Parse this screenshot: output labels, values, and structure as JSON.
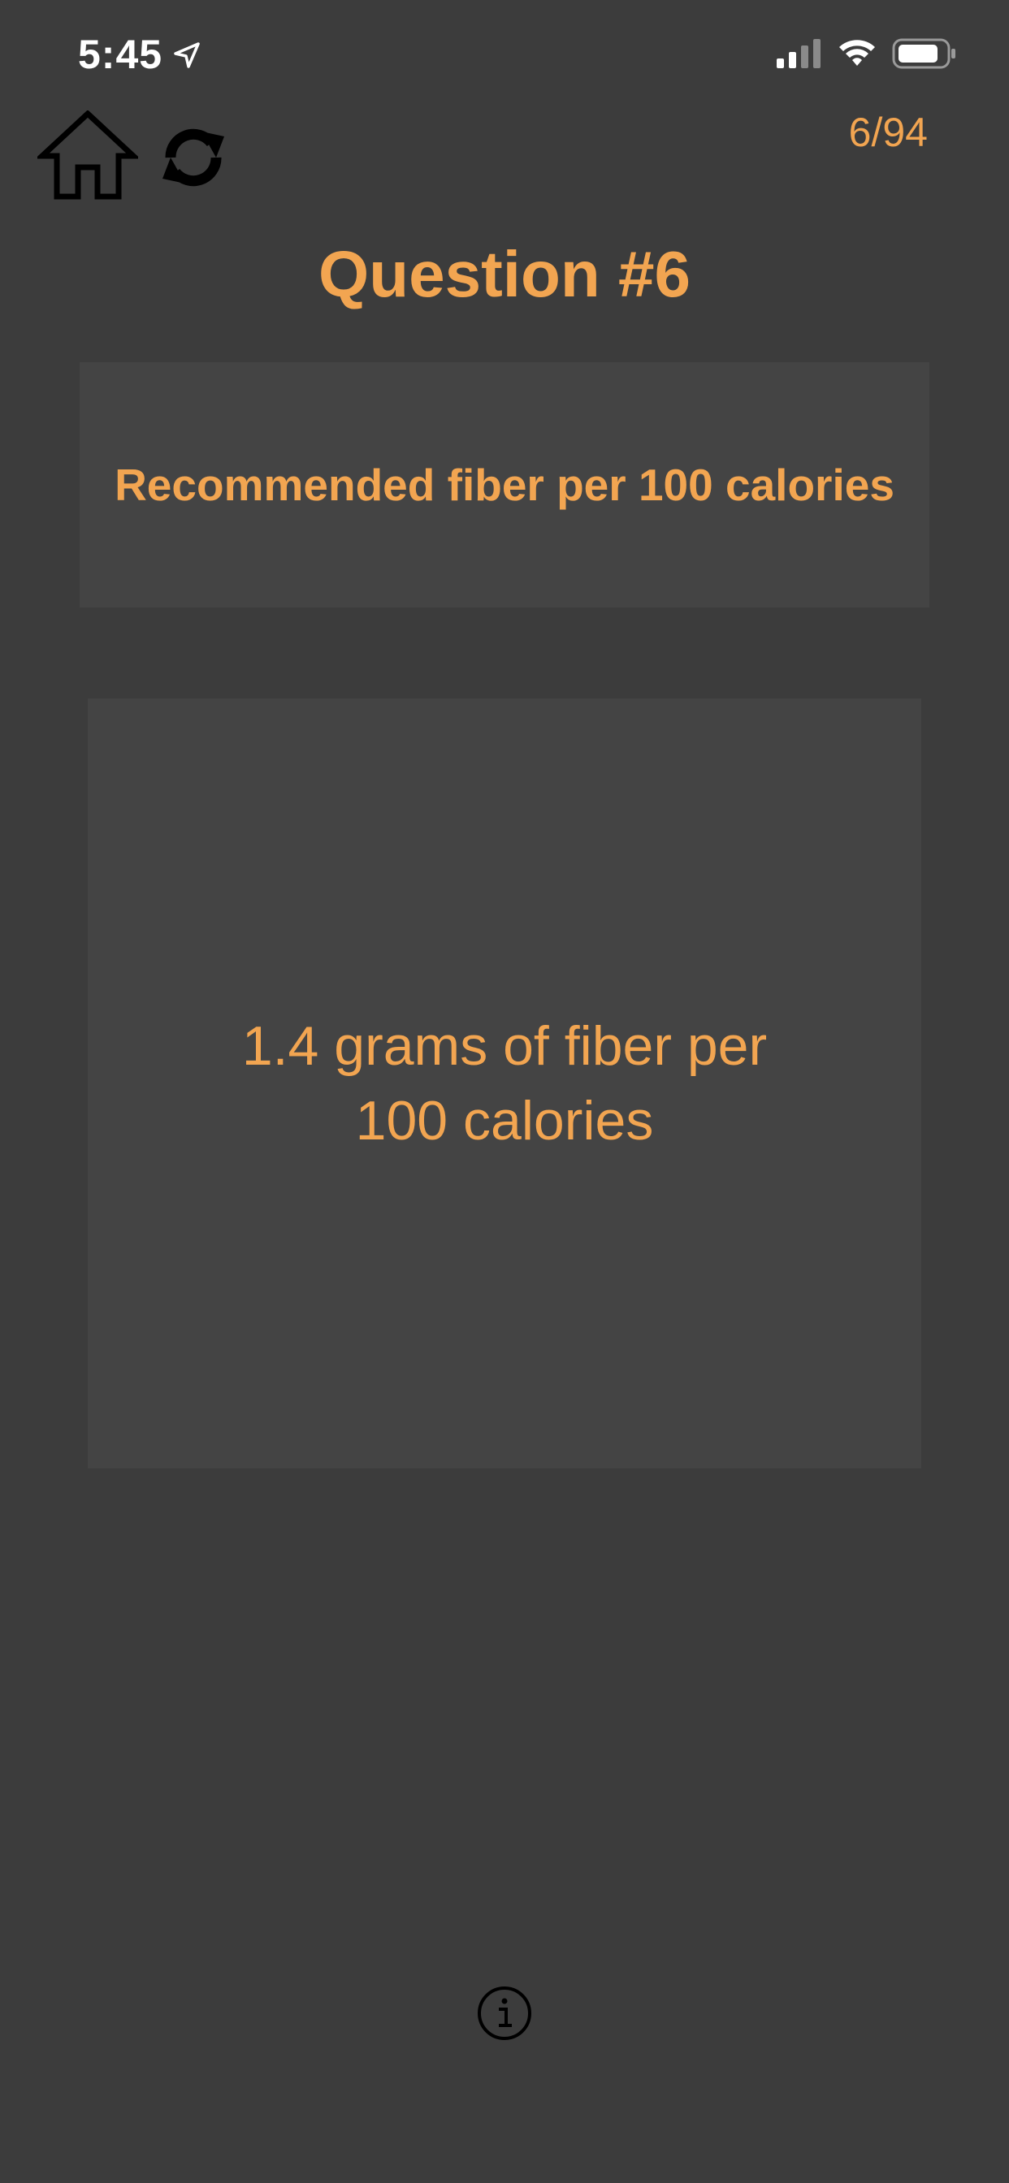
{
  "status_bar": {
    "time": "5:45",
    "icons": [
      "location-arrow-icon",
      "cellular-signal-icon",
      "wifi-icon",
      "battery-icon"
    ]
  },
  "toolbar": {
    "home_icon": "home-icon",
    "refresh_icon": "refresh-icon",
    "progress": "6/94"
  },
  "question": {
    "title": "Question #6",
    "prompt": "Recommended fiber per 100 calories",
    "answer": "1.4 grams of fiber per 100 calories"
  },
  "footer": {
    "info_icon": "info-icon"
  },
  "colors": {
    "background": "#3c3c3c",
    "card": "#444444",
    "accent": "#f2a551",
    "icon": "#000000"
  }
}
